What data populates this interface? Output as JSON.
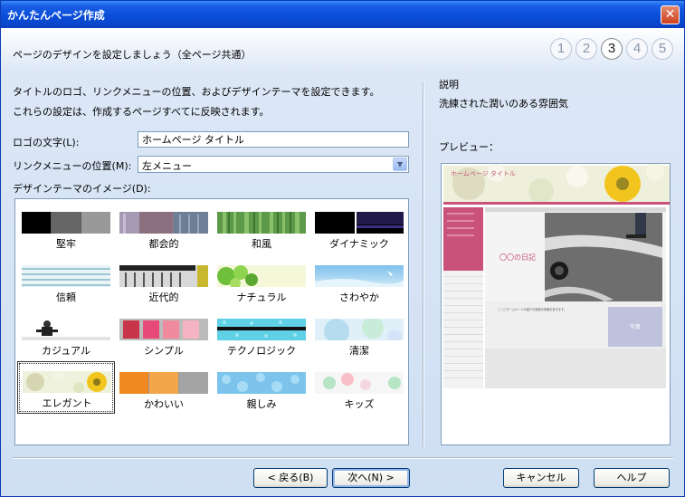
{
  "window": {
    "title": "かんたんページ作成"
  },
  "header": {
    "text": "ページのデザインを設定しましょう（全ページ共通）",
    "steps": [
      "1",
      "2",
      "3",
      "4",
      "5"
    ],
    "active_step": "3"
  },
  "left": {
    "description_line1": "タイトルのロゴ、リンクメニューの位置、およびデザインテーマを設定できます。",
    "description_line2": "これらの設定は、作成するページすべてに反映されます。",
    "logo_label": "ロゴの文字(L):",
    "logo_value": "ホームページ タイトル",
    "menu_label": "リンクメニューの位置(M):",
    "menu_value": "左メニュー",
    "theme_label": "デザインテーマのイメージ(D):",
    "themes": [
      "堅牢",
      "都会的",
      "和風",
      "ダイナミック",
      "信頼",
      "近代的",
      "ナチュラル",
      "さわやか",
      "カジュアル",
      "シンプル",
      "テクノロジック",
      "清潔",
      "エレガント",
      "かわいい",
      "親しみ",
      "キッズ"
    ],
    "selected_theme": "エレガント"
  },
  "right": {
    "explanation_title": "説明",
    "explanation_text": "洗練された潤いのある雰囲気",
    "preview_label": "プレビュー：",
    "preview": {
      "site_title": "ホームページ タイトル",
      "heading": "〇〇の日記",
      "body_text": "ここにホームページの紹介や最新の情報を書きます。",
      "photo_label": "写真"
    }
  },
  "buttons": {
    "back": "< 戻る(B)",
    "next": "次へ(N) >",
    "cancel": "キャンセル",
    "help": "ヘルプ"
  },
  "colors": {
    "titlebar": "#0b4ed9",
    "accent_pink": "#c8527a",
    "panel": "#dce7f6"
  },
  "icons": {
    "close": "close-icon",
    "dropdown": "chevron-down-icon"
  }
}
